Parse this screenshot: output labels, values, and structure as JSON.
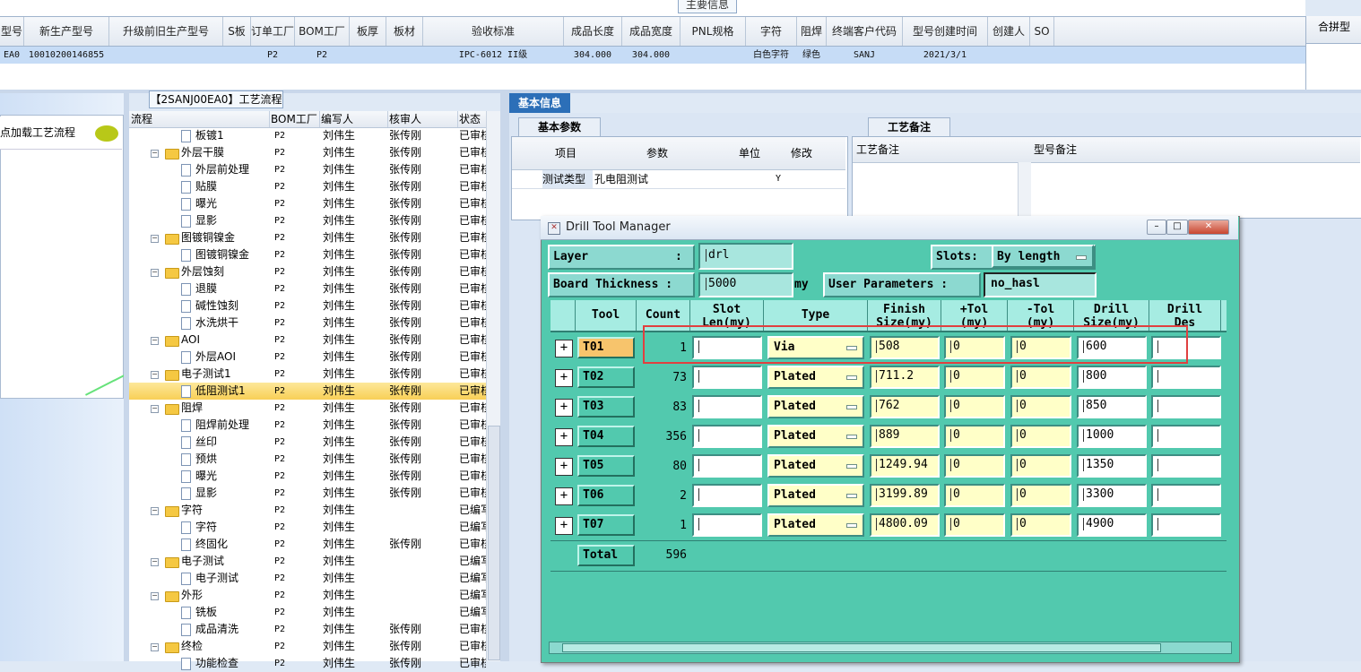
{
  "main_info": {
    "title": "主要信息",
    "columns": [
      "型号",
      "新生产型号",
      "升级前旧生产型号",
      "S板",
      "订单工厂",
      "BOM工厂",
      "板厚",
      "板材",
      "验收标准",
      "成品长度",
      "成品宽度",
      "PNL规格",
      "字符",
      "阻焊",
      "终端客户代码",
      "型号创建时间",
      "创建人",
      "SO"
    ],
    "row": [
      "EA0",
      "10010200146855",
      "",
      "",
      "P2",
      "P2",
      "",
      "",
      "IPC-6012 II级",
      "304.000",
      "304.000",
      "",
      "白色字符",
      "绿色",
      "SANJ",
      "2021/3/1",
      "",
      ""
    ],
    "combine_label": "合拼型"
  },
  "left_panel": {
    "load_text": "点加载工艺流程"
  },
  "tree": {
    "title": "【2SANJ00EA0】工艺流程",
    "columns": [
      "流程",
      "BOM工厂",
      "编写人",
      "核审人",
      "状态"
    ],
    "rows": [
      {
        "level": 1,
        "kind": "doc",
        "name": "板镀1",
        "bom": "P2",
        "writer": "刘伟生",
        "reviewer": "张传刚",
        "status": "已审核"
      },
      {
        "level": 0,
        "kind": "folder",
        "name": "外层干膜",
        "bom": "P2",
        "writer": "刘伟生",
        "reviewer": "张传刚",
        "status": "已审核"
      },
      {
        "level": 1,
        "kind": "doc",
        "name": "外层前处理",
        "bom": "P2",
        "writer": "刘伟生",
        "reviewer": "张传刚",
        "status": "已审核"
      },
      {
        "level": 1,
        "kind": "doc",
        "name": "贴膜",
        "bom": "P2",
        "writer": "刘伟生",
        "reviewer": "张传刚",
        "status": "已审核"
      },
      {
        "level": 1,
        "kind": "doc",
        "name": "曝光",
        "bom": "P2",
        "writer": "刘伟生",
        "reviewer": "张传刚",
        "status": "已审核"
      },
      {
        "level": 1,
        "kind": "doc",
        "name": "显影",
        "bom": "P2",
        "writer": "刘伟生",
        "reviewer": "张传刚",
        "status": "已审核"
      },
      {
        "level": 0,
        "kind": "folder",
        "name": "图镀铜镍金",
        "bom": "P2",
        "writer": "刘伟生",
        "reviewer": "张传刚",
        "status": "已审核"
      },
      {
        "level": 1,
        "kind": "doc",
        "name": "图镀铜镍金",
        "bom": "P2",
        "writer": "刘伟生",
        "reviewer": "张传刚",
        "status": "已审核"
      },
      {
        "level": 0,
        "kind": "folder",
        "name": "外层蚀刻",
        "bom": "P2",
        "writer": "刘伟生",
        "reviewer": "张传刚",
        "status": "已审核"
      },
      {
        "level": 1,
        "kind": "doc",
        "name": "退膜",
        "bom": "P2",
        "writer": "刘伟生",
        "reviewer": "张传刚",
        "status": "已审核"
      },
      {
        "level": 1,
        "kind": "doc",
        "name": "碱性蚀刻",
        "bom": "P2",
        "writer": "刘伟生",
        "reviewer": "张传刚",
        "status": "已审核"
      },
      {
        "level": 1,
        "kind": "doc",
        "name": "水洗烘干",
        "bom": "P2",
        "writer": "刘伟生",
        "reviewer": "张传刚",
        "status": "已审核"
      },
      {
        "level": 0,
        "kind": "folder",
        "name": "AOI",
        "bom": "P2",
        "writer": "刘伟生",
        "reviewer": "张传刚",
        "status": "已审核"
      },
      {
        "level": 1,
        "kind": "doc",
        "name": "外层AOI",
        "bom": "P2",
        "writer": "刘伟生",
        "reviewer": "张传刚",
        "status": "已审核"
      },
      {
        "level": 0,
        "kind": "folder",
        "name": "电子测试1",
        "bom": "P2",
        "writer": "刘伟生",
        "reviewer": "张传刚",
        "status": "已审核"
      },
      {
        "level": 1,
        "kind": "doc",
        "name": "低阻测试1",
        "bom": "P2",
        "writer": "刘伟生",
        "reviewer": "张传刚",
        "status": "已审核",
        "selected": true
      },
      {
        "level": 0,
        "kind": "folder",
        "name": "阻焊",
        "bom": "P2",
        "writer": "刘伟生",
        "reviewer": "张传刚",
        "status": "已审核"
      },
      {
        "level": 1,
        "kind": "doc",
        "name": "阻焊前处理",
        "bom": "P2",
        "writer": "刘伟生",
        "reviewer": "张传刚",
        "status": "已审核"
      },
      {
        "level": 1,
        "kind": "doc",
        "name": "丝印",
        "bom": "P2",
        "writer": "刘伟生",
        "reviewer": "张传刚",
        "status": "已审核"
      },
      {
        "level": 1,
        "kind": "doc",
        "name": "预烘",
        "bom": "P2",
        "writer": "刘伟生",
        "reviewer": "张传刚",
        "status": "已审核"
      },
      {
        "level": 1,
        "kind": "doc",
        "name": "曝光",
        "bom": "P2",
        "writer": "刘伟生",
        "reviewer": "张传刚",
        "status": "已审核"
      },
      {
        "level": 1,
        "kind": "doc",
        "name": "显影",
        "bom": "P2",
        "writer": "刘伟生",
        "reviewer": "张传刚",
        "status": "已审核"
      },
      {
        "level": 0,
        "kind": "folder",
        "name": "字符",
        "bom": "P2",
        "writer": "刘伟生",
        "reviewer": "",
        "status": "已编写"
      },
      {
        "level": 1,
        "kind": "doc",
        "name": "字符",
        "bom": "P2",
        "writer": "刘伟生",
        "reviewer": "",
        "status": "已编写"
      },
      {
        "level": 1,
        "kind": "doc",
        "name": "终固化",
        "bom": "P2",
        "writer": "刘伟生",
        "reviewer": "张传刚",
        "status": "已审核"
      },
      {
        "level": 0,
        "kind": "folder",
        "name": "电子测试",
        "bom": "P2",
        "writer": "刘伟生",
        "reviewer": "",
        "status": "已编写"
      },
      {
        "level": 1,
        "kind": "doc",
        "name": "电子测试",
        "bom": "P2",
        "writer": "刘伟生",
        "reviewer": "",
        "status": "已编写"
      },
      {
        "level": 0,
        "kind": "folder",
        "name": "外形",
        "bom": "P2",
        "writer": "刘伟生",
        "reviewer": "",
        "status": "已编写"
      },
      {
        "level": 1,
        "kind": "doc",
        "name": "铣板",
        "bom": "P2",
        "writer": "刘伟生",
        "reviewer": "",
        "status": "已编写"
      },
      {
        "level": 1,
        "kind": "doc",
        "name": "成品清洗",
        "bom": "P2",
        "writer": "刘伟生",
        "reviewer": "张传刚",
        "status": "已审核"
      },
      {
        "level": 0,
        "kind": "folder",
        "name": "终检",
        "bom": "P2",
        "writer": "刘伟生",
        "reviewer": "张传刚",
        "status": "已审核"
      },
      {
        "level": 1,
        "kind": "doc",
        "name": "功能检查",
        "bom": "P2",
        "writer": "刘伟生",
        "reviewer": "张传刚",
        "status": "已审核"
      }
    ]
  },
  "basic": {
    "tab": "基本信息",
    "param_tab": "基本参数",
    "param_columns": [
      "项目",
      "参数",
      "单位",
      "修改"
    ],
    "param_row": [
      "测试类型",
      "孔电阻测试",
      "",
      "Y"
    ],
    "note_tab": "工艺备注",
    "note_columns": [
      "工艺备注",
      "型号备注"
    ]
  },
  "dtm": {
    "title": "Drill Tool Manager",
    "layer_label": "Layer",
    "layer_colon": ":",
    "layer_value": "drl",
    "slots_label": "Slots:",
    "slots_value": "By length",
    "thickness_label": "Board Thickness :",
    "thickness_value": "5000",
    "thickness_unit": "my",
    "user_params_label": "User Parameters :",
    "user_params_value": "no_hasl",
    "columns": {
      "tool": "Tool",
      "count": "Count",
      "slot_1": "Slot",
      "slot_2": "Len(my)",
      "type": "Type",
      "finish_1": "Finish",
      "finish_2": "Size(my)",
      "ptol_1": "+Tol",
      "ptol_2": "(my)",
      "ntol_1": "-Tol",
      "ntol_2": "(my)",
      "drill_1": "Drill",
      "drill_2": "Size(my)",
      "des_1": "Drill",
      "des_2": "Des"
    },
    "rows": [
      {
        "tool": "T01",
        "count": "1",
        "type": "Via",
        "finish": "508",
        "ptol": "0",
        "ntol": "0",
        "drill": "600"
      },
      {
        "tool": "T02",
        "count": "73",
        "type": "Plated",
        "finish": "711.2",
        "ptol": "0",
        "ntol": "0",
        "drill": "800"
      },
      {
        "tool": "T03",
        "count": "83",
        "type": "Plated",
        "finish": "762",
        "ptol": "0",
        "ntol": "0",
        "drill": "850"
      },
      {
        "tool": "T04",
        "count": "356",
        "type": "Plated",
        "finish": "889",
        "ptol": "0",
        "ntol": "0",
        "drill": "1000"
      },
      {
        "tool": "T05",
        "count": "80",
        "type": "Plated",
        "finish": "1249.94",
        "ptol": "0",
        "ntol": "0",
        "drill": "1350"
      },
      {
        "tool": "T06",
        "count": "2",
        "type": "Plated",
        "finish": "3199.89",
        "ptol": "0",
        "ntol": "0",
        "drill": "3300"
      },
      {
        "tool": "T07",
        "count": "1",
        "type": "Plated",
        "finish": "4800.09",
        "ptol": "0",
        "ntol": "0",
        "drill": "4900"
      }
    ],
    "total_label": "Total",
    "total_value": "596"
  }
}
